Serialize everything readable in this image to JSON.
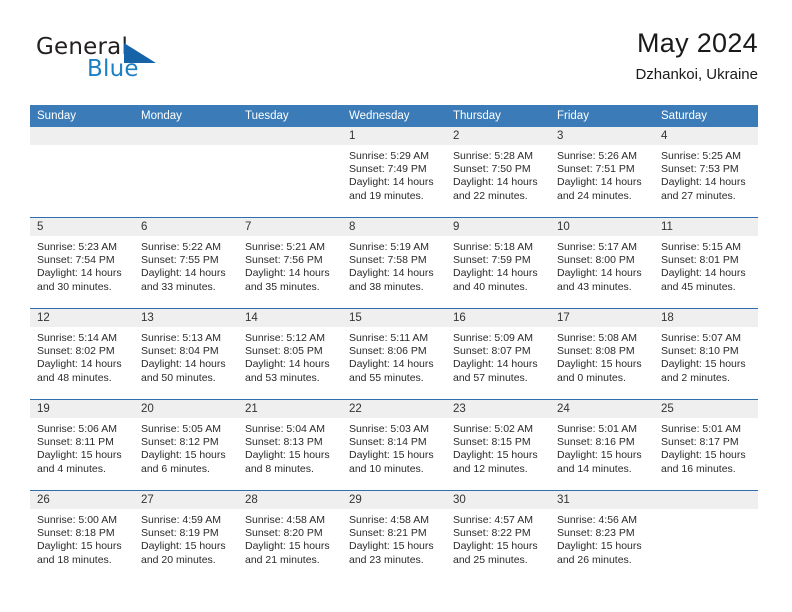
{
  "brand": {
    "name_part1": "General",
    "name_part2": "Blue",
    "triangle_color": "#1763a8",
    "blue_color": "#1d7fc3"
  },
  "header": {
    "title": "May 2024",
    "subtitle": "Dzhankoi, Ukraine"
  },
  "theme": {
    "header_blue": "#3b7cb8",
    "row_divider": "#2f6fad",
    "daynum_band": "#efefef"
  },
  "weekdays": [
    "Sunday",
    "Monday",
    "Tuesday",
    "Wednesday",
    "Thursday",
    "Friday",
    "Saturday"
  ],
  "labels": {
    "sunrise": "Sunrise:",
    "sunset": "Sunset:",
    "daylight": "Daylight:"
  },
  "weeks": [
    [
      {
        "day": "",
        "empty": true
      },
      {
        "day": "",
        "empty": true
      },
      {
        "day": "",
        "empty": true
      },
      {
        "day": "1",
        "sunrise": "Sunrise: 5:29 AM",
        "sunset": "Sunset: 7:49 PM",
        "daylight1": "Daylight: 14 hours",
        "daylight2": "and 19 minutes."
      },
      {
        "day": "2",
        "sunrise": "Sunrise: 5:28 AM",
        "sunset": "Sunset: 7:50 PM",
        "daylight1": "Daylight: 14 hours",
        "daylight2": "and 22 minutes."
      },
      {
        "day": "3",
        "sunrise": "Sunrise: 5:26 AM",
        "sunset": "Sunset: 7:51 PM",
        "daylight1": "Daylight: 14 hours",
        "daylight2": "and 24 minutes."
      },
      {
        "day": "4",
        "sunrise": "Sunrise: 5:25 AM",
        "sunset": "Sunset: 7:53 PM",
        "daylight1": "Daylight: 14 hours",
        "daylight2": "and 27 minutes."
      }
    ],
    [
      {
        "day": "5",
        "sunrise": "Sunrise: 5:23 AM",
        "sunset": "Sunset: 7:54 PM",
        "daylight1": "Daylight: 14 hours",
        "daylight2": "and 30 minutes."
      },
      {
        "day": "6",
        "sunrise": "Sunrise: 5:22 AM",
        "sunset": "Sunset: 7:55 PM",
        "daylight1": "Daylight: 14 hours",
        "daylight2": "and 33 minutes."
      },
      {
        "day": "7",
        "sunrise": "Sunrise: 5:21 AM",
        "sunset": "Sunset: 7:56 PM",
        "daylight1": "Daylight: 14 hours",
        "daylight2": "and 35 minutes."
      },
      {
        "day": "8",
        "sunrise": "Sunrise: 5:19 AM",
        "sunset": "Sunset: 7:58 PM",
        "daylight1": "Daylight: 14 hours",
        "daylight2": "and 38 minutes."
      },
      {
        "day": "9",
        "sunrise": "Sunrise: 5:18 AM",
        "sunset": "Sunset: 7:59 PM",
        "daylight1": "Daylight: 14 hours",
        "daylight2": "and 40 minutes."
      },
      {
        "day": "10",
        "sunrise": "Sunrise: 5:17 AM",
        "sunset": "Sunset: 8:00 PM",
        "daylight1": "Daylight: 14 hours",
        "daylight2": "and 43 minutes."
      },
      {
        "day": "11",
        "sunrise": "Sunrise: 5:15 AM",
        "sunset": "Sunset: 8:01 PM",
        "daylight1": "Daylight: 14 hours",
        "daylight2": "and 45 minutes."
      }
    ],
    [
      {
        "day": "12",
        "sunrise": "Sunrise: 5:14 AM",
        "sunset": "Sunset: 8:02 PM",
        "daylight1": "Daylight: 14 hours",
        "daylight2": "and 48 minutes."
      },
      {
        "day": "13",
        "sunrise": "Sunrise: 5:13 AM",
        "sunset": "Sunset: 8:04 PM",
        "daylight1": "Daylight: 14 hours",
        "daylight2": "and 50 minutes."
      },
      {
        "day": "14",
        "sunrise": "Sunrise: 5:12 AM",
        "sunset": "Sunset: 8:05 PM",
        "daylight1": "Daylight: 14 hours",
        "daylight2": "and 53 minutes."
      },
      {
        "day": "15",
        "sunrise": "Sunrise: 5:11 AM",
        "sunset": "Sunset: 8:06 PM",
        "daylight1": "Daylight: 14 hours",
        "daylight2": "and 55 minutes."
      },
      {
        "day": "16",
        "sunrise": "Sunrise: 5:09 AM",
        "sunset": "Sunset: 8:07 PM",
        "daylight1": "Daylight: 14 hours",
        "daylight2": "and 57 minutes."
      },
      {
        "day": "17",
        "sunrise": "Sunrise: 5:08 AM",
        "sunset": "Sunset: 8:08 PM",
        "daylight1": "Daylight: 15 hours",
        "daylight2": "and 0 minutes."
      },
      {
        "day": "18",
        "sunrise": "Sunrise: 5:07 AM",
        "sunset": "Sunset: 8:10 PM",
        "daylight1": "Daylight: 15 hours",
        "daylight2": "and 2 minutes."
      }
    ],
    [
      {
        "day": "19",
        "sunrise": "Sunrise: 5:06 AM",
        "sunset": "Sunset: 8:11 PM",
        "daylight1": "Daylight: 15 hours",
        "daylight2": "and 4 minutes."
      },
      {
        "day": "20",
        "sunrise": "Sunrise: 5:05 AM",
        "sunset": "Sunset: 8:12 PM",
        "daylight1": "Daylight: 15 hours",
        "daylight2": "and 6 minutes."
      },
      {
        "day": "21",
        "sunrise": "Sunrise: 5:04 AM",
        "sunset": "Sunset: 8:13 PM",
        "daylight1": "Daylight: 15 hours",
        "daylight2": "and 8 minutes."
      },
      {
        "day": "22",
        "sunrise": "Sunrise: 5:03 AM",
        "sunset": "Sunset: 8:14 PM",
        "daylight1": "Daylight: 15 hours",
        "daylight2": "and 10 minutes."
      },
      {
        "day": "23",
        "sunrise": "Sunrise: 5:02 AM",
        "sunset": "Sunset: 8:15 PM",
        "daylight1": "Daylight: 15 hours",
        "daylight2": "and 12 minutes."
      },
      {
        "day": "24",
        "sunrise": "Sunrise: 5:01 AM",
        "sunset": "Sunset: 8:16 PM",
        "daylight1": "Daylight: 15 hours",
        "daylight2": "and 14 minutes."
      },
      {
        "day": "25",
        "sunrise": "Sunrise: 5:01 AM",
        "sunset": "Sunset: 8:17 PM",
        "daylight1": "Daylight: 15 hours",
        "daylight2": "and 16 minutes."
      }
    ],
    [
      {
        "day": "26",
        "sunrise": "Sunrise: 5:00 AM",
        "sunset": "Sunset: 8:18 PM",
        "daylight1": "Daylight: 15 hours",
        "daylight2": "and 18 minutes."
      },
      {
        "day": "27",
        "sunrise": "Sunrise: 4:59 AM",
        "sunset": "Sunset: 8:19 PM",
        "daylight1": "Daylight: 15 hours",
        "daylight2": "and 20 minutes."
      },
      {
        "day": "28",
        "sunrise": "Sunrise: 4:58 AM",
        "sunset": "Sunset: 8:20 PM",
        "daylight1": "Daylight: 15 hours",
        "daylight2": "and 21 minutes."
      },
      {
        "day": "29",
        "sunrise": "Sunrise: 4:58 AM",
        "sunset": "Sunset: 8:21 PM",
        "daylight1": "Daylight: 15 hours",
        "daylight2": "and 23 minutes."
      },
      {
        "day": "30",
        "sunrise": "Sunrise: 4:57 AM",
        "sunset": "Sunset: 8:22 PM",
        "daylight1": "Daylight: 15 hours",
        "daylight2": "and 25 minutes."
      },
      {
        "day": "31",
        "sunrise": "Sunrise: 4:56 AM",
        "sunset": "Sunset: 8:23 PM",
        "daylight1": "Daylight: 15 hours",
        "daylight2": "and 26 minutes."
      },
      {
        "day": "",
        "empty": true
      }
    ]
  ]
}
